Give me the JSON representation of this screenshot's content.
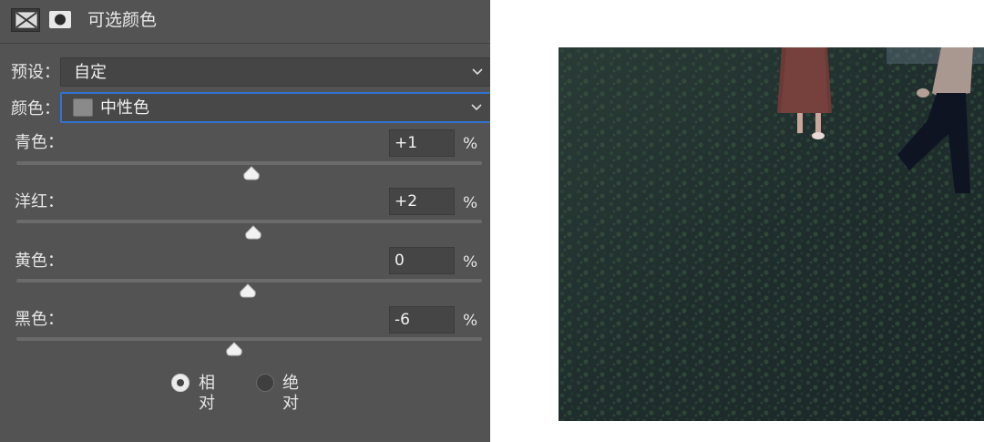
{
  "panel": {
    "title": "可选颜色",
    "preset": {
      "label": "预设：",
      "value": "自定"
    },
    "colors": {
      "label": "颜色：",
      "value": "中性色",
      "swatch_color": "#8a8a8a"
    },
    "sliders": [
      {
        "label": "青色：",
        "value": "+1",
        "unit": "%",
        "level": 1
      },
      {
        "label": "洋红：",
        "value": "+2",
        "unit": "%",
        "level": 2
      },
      {
        "label": "黄色：",
        "value": "0",
        "unit": "%",
        "level": 0
      },
      {
        "label": "黑色：",
        "value": "-6",
        "unit": "%",
        "level": -6
      }
    ],
    "method": {
      "relative": "相对",
      "absolute": "绝对",
      "selected": "relative"
    },
    "accent_color": "#2f73d4"
  }
}
